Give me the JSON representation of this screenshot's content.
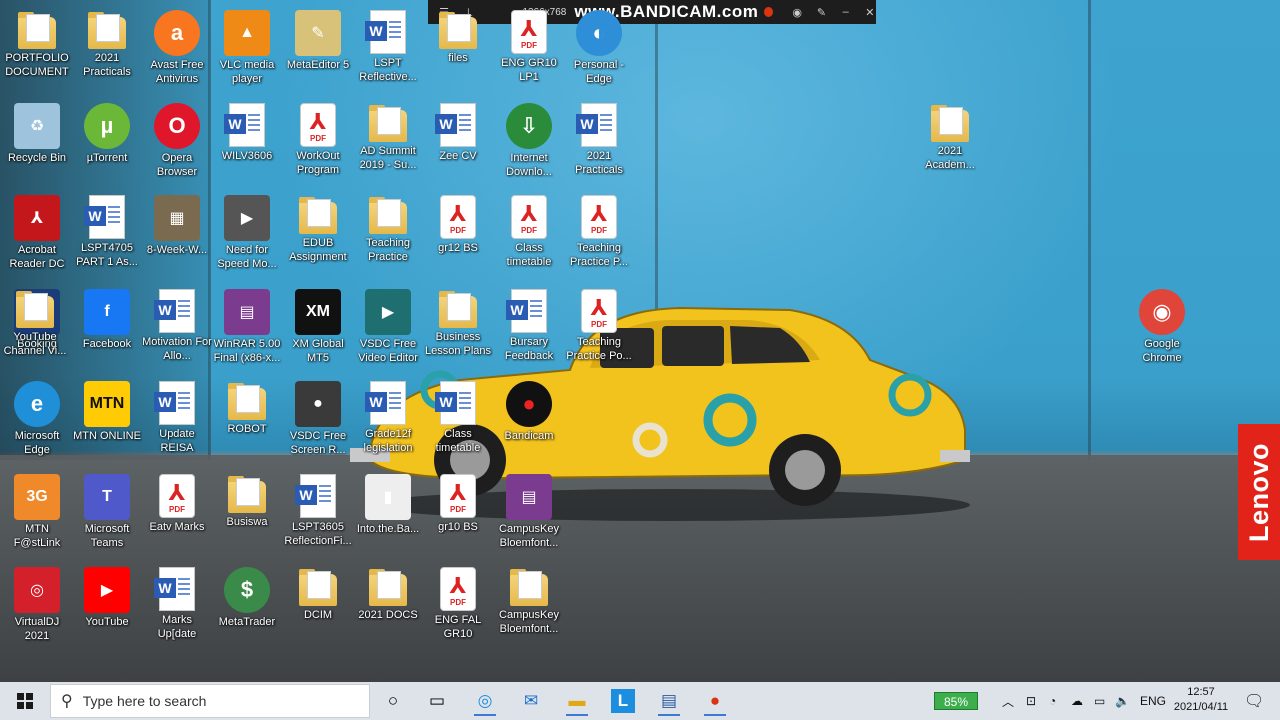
{
  "recorder": {
    "resolution": "1366x768",
    "brand": "www.BANDICAM.com"
  },
  "brand_tag": "Lenovo",
  "desktop_icons": [
    {
      "label": "PORTFOLIO DOCUMENTS",
      "icon": "folder-icon"
    },
    {
      "label": "2021 Practicals",
      "icon": "folder-icon"
    },
    {
      "label": "Avast Free Antivirus",
      "icon": "avast-icon"
    },
    {
      "label": "VLC media player",
      "icon": "vlc-icon"
    },
    {
      "label": "MetaEditor 5",
      "icon": "metaeditor-icon"
    },
    {
      "label": "LSPT Reflective...",
      "icon": "word-doc-icon"
    },
    {
      "label": "files",
      "icon": "folder-icon"
    },
    {
      "label": "ENG GR10 LP1",
      "icon": "pdf-icon"
    },
    {
      "label": "Personal - Edge",
      "icon": "edge-profile-icon"
    },
    {
      "label": "Recycle Bin",
      "icon": "recycle-bin-icon"
    },
    {
      "label": "µTorrent",
      "icon": "utorrent-icon"
    },
    {
      "label": "Opera Browser",
      "icon": "opera-icon"
    },
    {
      "label": "WILV3606",
      "icon": "word-doc-icon"
    },
    {
      "label": "WorkOut Program",
      "icon": "pdf-icon"
    },
    {
      "label": "AD Summit 2019 - Su...",
      "icon": "folder-icon"
    },
    {
      "label": "Zee CV",
      "icon": "word-doc-icon"
    },
    {
      "label": "Internet Downlo...",
      "icon": "idm-icon"
    },
    {
      "label": "2021 Practicals",
      "icon": "word-doc-icon"
    },
    {
      "label": "2021 Academ...",
      "icon": "folder-icon"
    },
    {
      "label": "Acrobat Reader DC",
      "icon": "acrobat-icon"
    },
    {
      "label": "LSPT4705 PART 1 As...",
      "icon": "word-doc-icon"
    },
    {
      "label": "8-Week-W...",
      "icon": "image-icon"
    },
    {
      "label": "Need for Speed Mo...",
      "icon": "nfs-icon"
    },
    {
      "label": "EDUB Assignment",
      "icon": "folder-icon"
    },
    {
      "label": "Teaching Practice",
      "icon": "folder-icon"
    },
    {
      "label": "gr12 BS",
      "icon": "pdf-icon"
    },
    {
      "label": "Class timetable",
      "icon": "pdf-icon"
    },
    {
      "label": "Teaching Practice P...",
      "icon": "pdf-icon"
    },
    {
      "label": "Booking",
      "icon": "booking-icon"
    },
    {
      "label": "Facebook",
      "icon": "facebook-icon"
    },
    {
      "label": "Motivation For Allo...",
      "icon": "word-doc-icon"
    },
    {
      "label": "WinRAR 5.00 Final (x86-x...",
      "icon": "winrar-icon"
    },
    {
      "label": "XM Global MT5",
      "icon": "xm-icon"
    },
    {
      "label": "VSDC Free Video Editor",
      "icon": "vsdc-icon"
    },
    {
      "label": "Business Lesson Plans",
      "icon": "folder-icon"
    },
    {
      "label": "Bursary Feedback",
      "icon": "word-doc-icon"
    },
    {
      "label": "Teaching Practice Po...",
      "icon": "pdf-icon"
    },
    {
      "label": "YouTube Channel Vi...",
      "icon": "folder-icon"
    },
    {
      "label": "Google Chrome",
      "icon": "chrome-icon"
    },
    {
      "label": "Microsoft Edge",
      "icon": "edge-icon"
    },
    {
      "label": "MTN ONLINE",
      "icon": "mtn-icon"
    },
    {
      "label": "Update REISA",
      "icon": "word-doc-icon"
    },
    {
      "label": "ROBOT",
      "icon": "folder-icon"
    },
    {
      "label": "VSDC Free Screen R...",
      "icon": "vsdc-recorder-icon"
    },
    {
      "label": "Grade12f legislation",
      "icon": "word-doc-icon"
    },
    {
      "label": "Class timetable",
      "icon": "word-doc-icon"
    },
    {
      "label": "Bandicam",
      "icon": "bandicam-icon"
    },
    {
      "label": "MTN F@stLink",
      "icon": "mtn-fastlink-icon"
    },
    {
      "label": "Microsoft Teams",
      "icon": "teams-icon"
    },
    {
      "label": "Eatv Marks",
      "icon": "pdf-icon"
    },
    {
      "label": "Busiswa",
      "icon": "folder-icon"
    },
    {
      "label": "LSPT3605 ReflectionFi...",
      "icon": "word-doc-icon"
    },
    {
      "label": "Into.the.Ba...",
      "icon": "archive-icon"
    },
    {
      "label": "gr10 BS",
      "icon": "pdf-icon"
    },
    {
      "label": "CampusKey Bloemfont...",
      "icon": "winrar-icon"
    },
    {
      "label": "VirtualDJ 2021",
      "icon": "virtualdj-icon"
    },
    {
      "label": "YouTube",
      "icon": "youtube-icon"
    },
    {
      "label": "Marks Up[date",
      "icon": "word-doc-icon"
    },
    {
      "label": "MetaTrader",
      "icon": "metatrader-icon"
    },
    {
      "label": "DCIM",
      "icon": "folder-icon"
    },
    {
      "label": "2021 DOCS",
      "icon": "folder-icon"
    },
    {
      "label": "ENG FAL GR10",
      "icon": "pdf-icon"
    },
    {
      "label": "CampusKey Bloemfont...",
      "icon": "folder-icon"
    }
  ],
  "taskbar": {
    "search_placeholder": "Type here to search",
    "battery": "85%",
    "language": "ENG",
    "time": "12:57",
    "date": "2021/04/11"
  }
}
